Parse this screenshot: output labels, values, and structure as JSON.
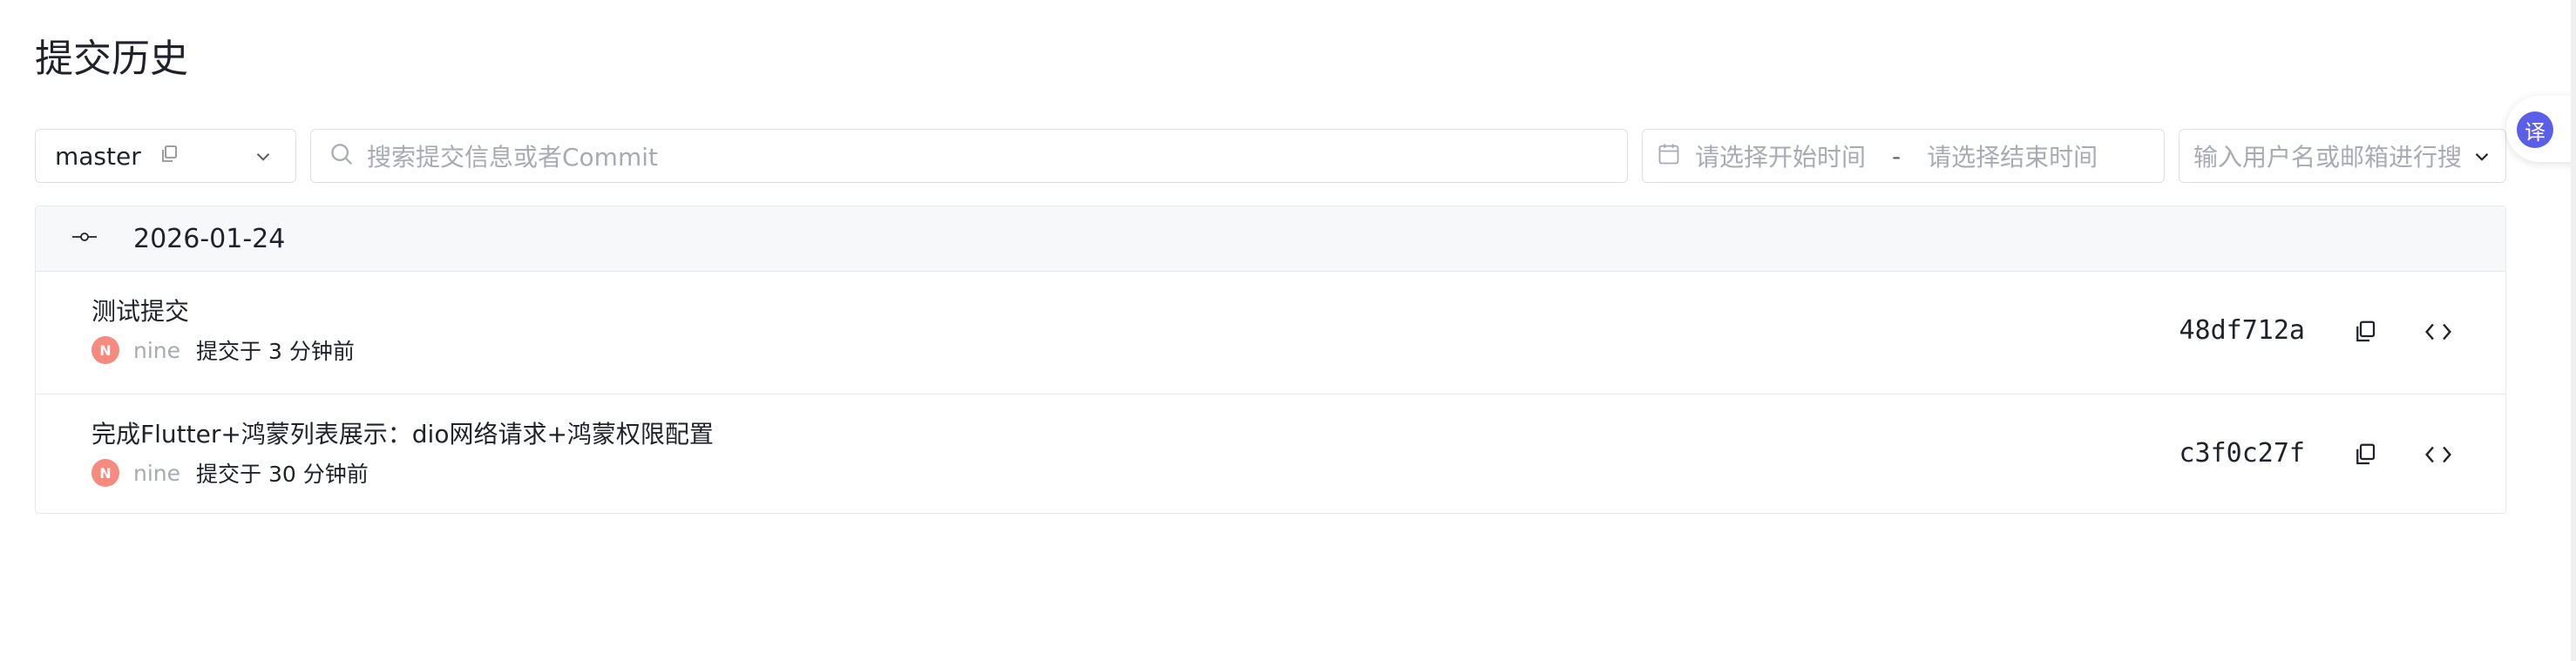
{
  "page": {
    "title": "提交历史"
  },
  "filters": {
    "branch": "master",
    "search_placeholder": "搜索提交信息或者Commit",
    "date_start_placeholder": "请选择开始时间",
    "date_separator": "-",
    "date_end_placeholder": "请选择结束时间",
    "user_placeholder": "输入用户名或邮箱进行搜"
  },
  "groups": [
    {
      "date": "2026-01-24",
      "commits": [
        {
          "message": "测试提交",
          "avatar": "N",
          "author": "nine",
          "time": "提交于 3 分钟前",
          "hash": "48df712a"
        },
        {
          "message": "完成Flutter+鸿蒙列表展示：dio网络请求+鸿蒙权限配置",
          "avatar": "N",
          "author": "nine",
          "time": "提交于 30 分钟前",
          "hash": "c3f0c27f"
        }
      ]
    }
  ],
  "translate": {
    "label": "译"
  },
  "colors": {
    "avatar": "#f58a7f",
    "translate": "#5b5fe8",
    "border": "#dcdfe6"
  },
  "icons": [
    "copy-icon",
    "chevron-down-icon",
    "search-icon",
    "calendar-icon",
    "commit-icon",
    "code-icon"
  ]
}
